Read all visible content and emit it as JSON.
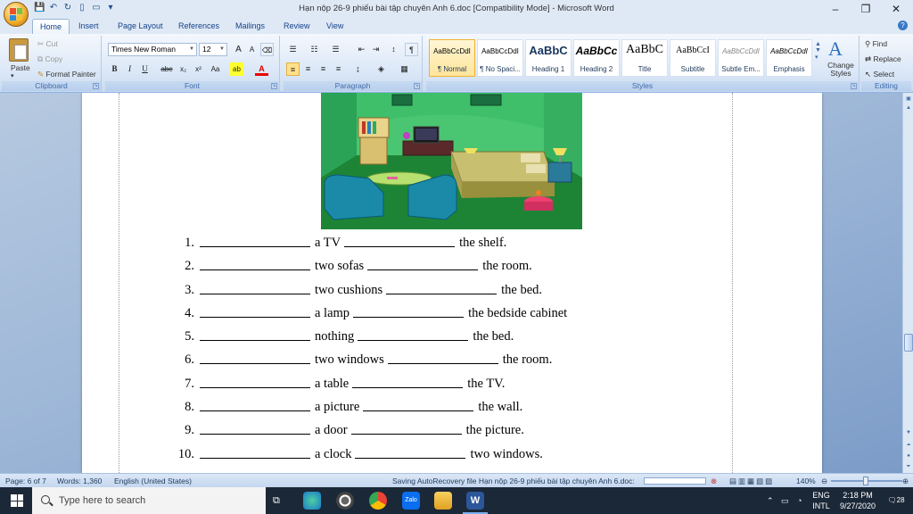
{
  "window": {
    "title": "Hạn nộp 26-9 phiếu bài tập chuyên Anh 6.doc [Compatibility Mode] - Microsoft Word",
    "minimize": "–",
    "restore": "❐",
    "close": "✕"
  },
  "tabs": [
    "Home",
    "Insert",
    "Page Layout",
    "References",
    "Mailings",
    "Review",
    "View"
  ],
  "ribbon": {
    "clipboard": {
      "label": "Clipboard",
      "paste": "Paste",
      "cut": "Cut",
      "copy": "Copy",
      "format_painter": "Format Painter"
    },
    "font": {
      "label": "Font",
      "family": "Times New Roman",
      "size": "12",
      "bold": "B",
      "italic": "I",
      "underline": "U",
      "strike": "abe",
      "subscript": "x₂",
      "superscript": "x²",
      "change_case": "Aa",
      "grow": "A",
      "shrink": "A"
    },
    "paragraph": {
      "label": "Paragraph"
    },
    "styles": {
      "label": "Styles",
      "items": [
        {
          "preview": "AaBbCcDdI",
          "name": "¶ Normal"
        },
        {
          "preview": "AaBbCcDdI",
          "name": "¶ No Spaci..."
        },
        {
          "preview": "AaBbC",
          "name": "Heading 1"
        },
        {
          "preview": "AaBbCc",
          "name": "Heading 2"
        },
        {
          "preview": "AaBbC",
          "name": "Title"
        },
        {
          "preview": "AaBbCcI",
          "name": "Subtitle"
        },
        {
          "preview": "AaBbCcDdI",
          "name": "Subtle Em..."
        },
        {
          "preview": "AaBbCcDdI",
          "name": "Emphasis"
        }
      ],
      "change_styles": "Change Styles"
    },
    "editing": {
      "label": "Editing",
      "find": "Find",
      "replace": "Replace",
      "select": "Select"
    }
  },
  "document": {
    "exercise": [
      {
        "num": "1.",
        "mid": "a TV",
        "end": "the shelf."
      },
      {
        "num": "2.",
        "mid": "two sofas",
        "end": "the room."
      },
      {
        "num": "3.",
        "mid": "two cushions",
        "end": "the bed."
      },
      {
        "num": "4.",
        "mid": "a lamp",
        "end": "the bedside cabinet"
      },
      {
        "num": "5.",
        "mid": "nothing",
        "end": "the bed."
      },
      {
        "num": "6.",
        "mid": "two windows",
        "end": "the room."
      },
      {
        "num": "7.",
        "mid": "a table",
        "end": "the TV."
      },
      {
        "num": "8.",
        "mid": "a picture",
        "end": "the wall."
      },
      {
        "num": "9.",
        "mid": "a door",
        "end": "the picture."
      },
      {
        "num": "10.",
        "mid": "a clock",
        "end": "two windows."
      }
    ]
  },
  "status": {
    "page": "Page: 6 of 7",
    "words": "Words: 1,360",
    "language": "English (United States)",
    "autorecovery": "Saving AutoRecovery file Hạn nộp 26-9 phiếu bài tập chuyên Anh 6.doc:",
    "zoom": "140%"
  },
  "taskbar": {
    "search_placeholder": "Type here to search",
    "lang_top": "ENG",
    "lang_bottom": "INTL",
    "time": "2:18 PM",
    "date": "9/27/2020",
    "notifications": "28"
  },
  "colors": {
    "ribbon_accent": "#15428b",
    "room_green": "#1f8a3a",
    "taskbar": "#1b2838"
  }
}
